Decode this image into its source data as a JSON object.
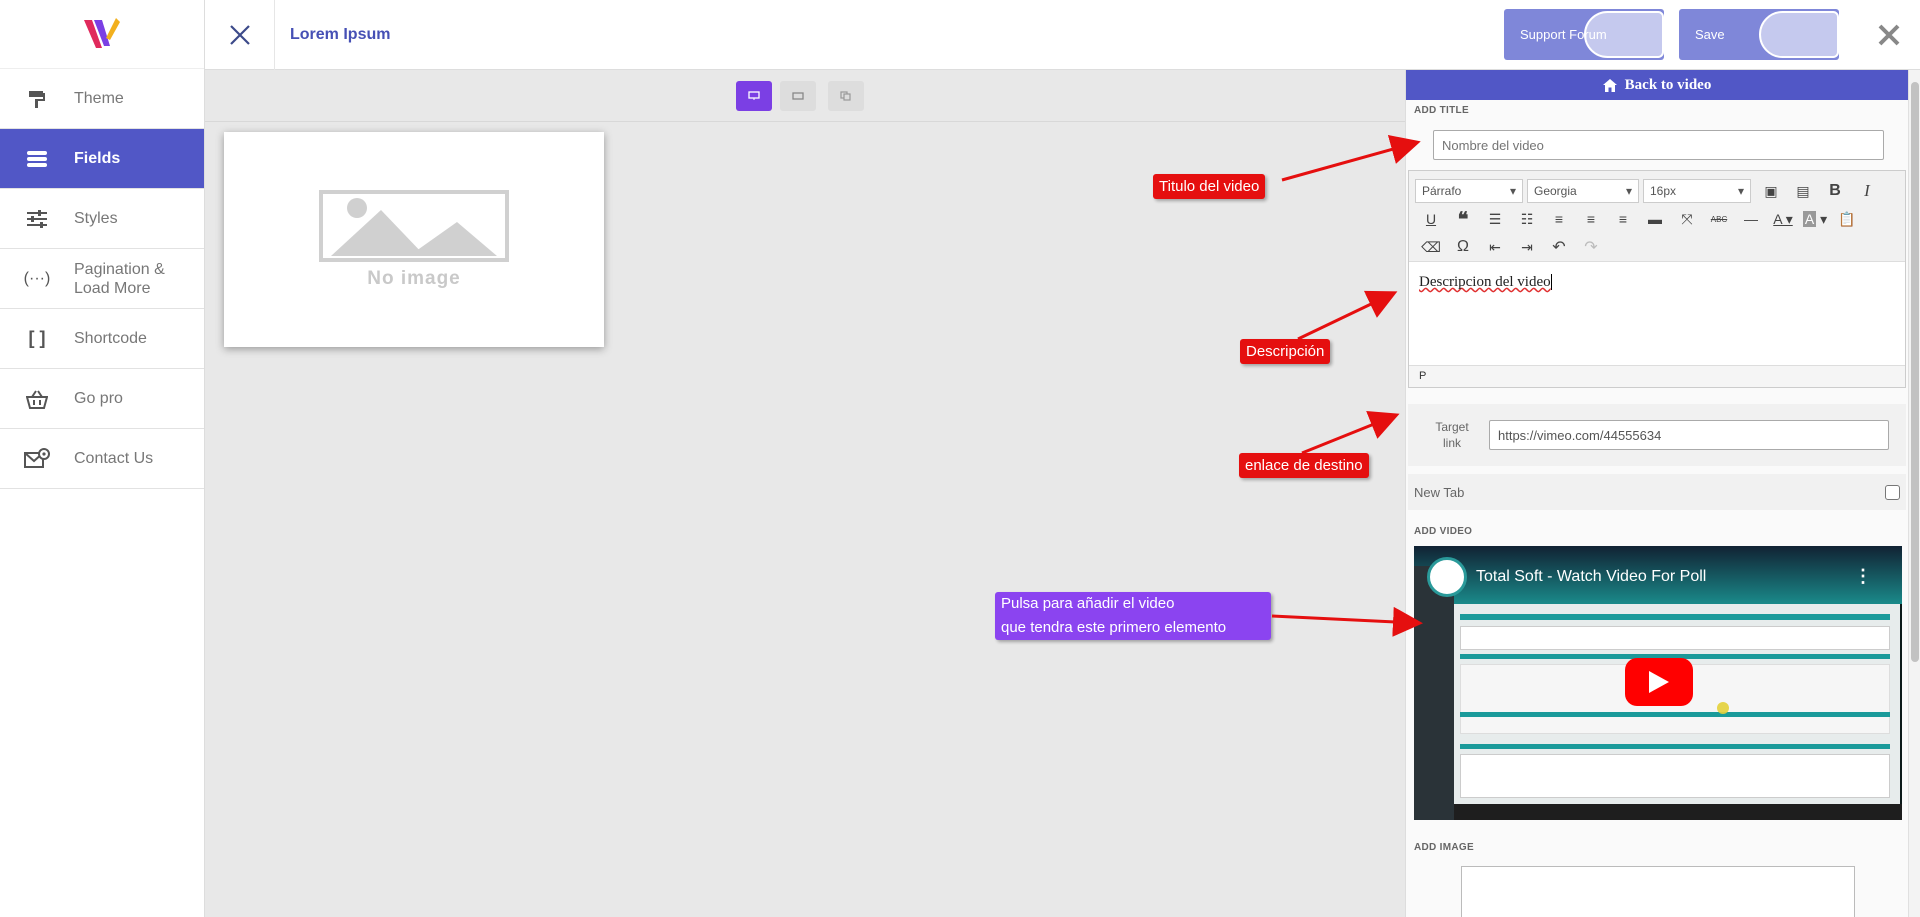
{
  "topbar": {
    "title": "Lorem Ipsum",
    "support_label": "Support Forum",
    "save_label": "Save"
  },
  "sidebar": {
    "items": [
      {
        "label": "Theme",
        "icon": "paint-roller-icon",
        "active": false
      },
      {
        "label": "Fields",
        "icon": "database-icon",
        "active": true
      },
      {
        "label": "Styles",
        "icon": "sliders-icon",
        "active": false
      },
      {
        "label": "Pagination & Load More",
        "icon": "ellipsis-icon",
        "active": false
      },
      {
        "label": "Shortcode",
        "icon": "brackets-icon",
        "active": false
      },
      {
        "label": "Go pro",
        "icon": "basket-icon",
        "active": false
      },
      {
        "label": "Contact Us",
        "icon": "mail-at-icon",
        "active": false
      }
    ]
  },
  "preview": {
    "no_image": "No image"
  },
  "panel": {
    "back_label": "Back to video",
    "add_title_label": "ADD TITLE",
    "title_placeholder": "Nombre del video",
    "editor": {
      "format": "Párrafo",
      "font": "Georgia",
      "size": "16px",
      "content": "Descripcion del video",
      "status": "P"
    },
    "target_label_1": "Target",
    "target_label_2": "link",
    "target_value": "https://vimeo.com/44555634",
    "new_tab_label": "New Tab",
    "add_video_label": "ADD VIDEO",
    "video_title": "Total Soft - Watch Video For Poll",
    "add_image_label": "ADD IMAGE"
  },
  "callouts": {
    "title": "Titulo del video",
    "description": "Descripción",
    "link": "enlace de destino",
    "video_line1": "Pulsa para añadir el video",
    "video_line2": "que tendra este primero elemento"
  },
  "colors": {
    "accent": "#5157c6",
    "callout_red": "#e50f0f",
    "callout_purple": "#8b44f0"
  }
}
